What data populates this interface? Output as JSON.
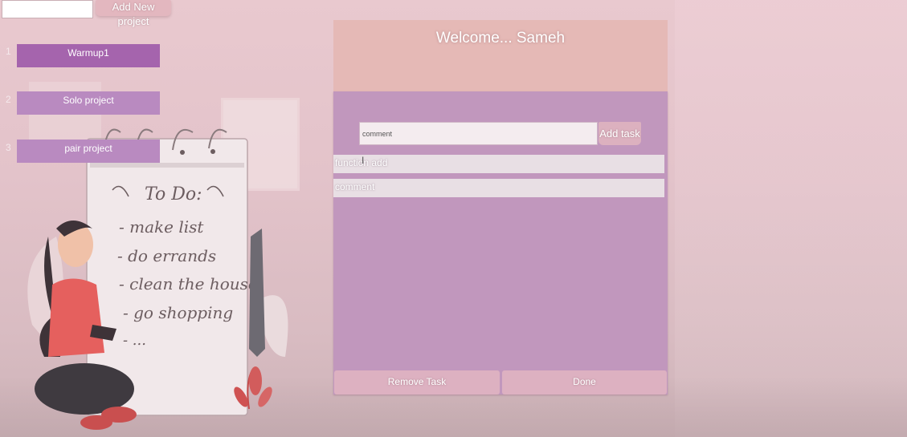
{
  "header": {
    "new_project_input_value": "",
    "add_project_label": "Add New project"
  },
  "projects": [
    {
      "number": "1",
      "label": "Warmup1"
    },
    {
      "number": "2",
      "label": "Solo project"
    },
    {
      "number": "3",
      "label": "pair project"
    }
  ],
  "illustration": {
    "todo_title": "To Do:",
    "todo_items": [
      "- make list",
      "- do errands",
      "- clean the house",
      "- go shopping",
      "- ..."
    ]
  },
  "panel": {
    "welcome": "Welcome... Sameh",
    "task_input_value": "comment",
    "add_task_label": "Add task",
    "tasks": [
      "function add",
      "comment"
    ],
    "remove_label": "Remove Task",
    "done_label": "Done"
  },
  "colors": {
    "active_project": "#a564ad",
    "project": "#b98ac0",
    "panel_header": "#e5b9b6",
    "panel_body": "#c197bd"
  }
}
